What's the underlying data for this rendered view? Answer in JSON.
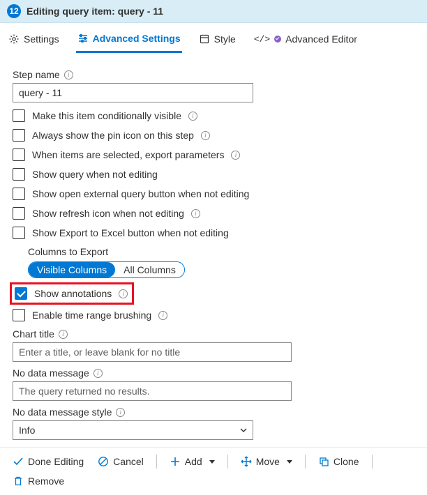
{
  "header": {
    "badge": "12",
    "title": "Editing query item: query - 11"
  },
  "tabs": {
    "settings": "Settings",
    "advanced": "Advanced Settings",
    "style": "Style",
    "editor": "Advanced Editor"
  },
  "stepName": {
    "label": "Step name",
    "value": "query - 11"
  },
  "checks": {
    "conditional": "Make this item conditionally visible",
    "pin": "Always show the pin icon on this step",
    "export": "When items are selected, export parameters",
    "showQuery": "Show query when not editing",
    "openExternal": "Show open external query button when not editing",
    "refresh": "Show refresh icon when not editing",
    "excel": "Show Export to Excel button when not editing",
    "annotations": "Show annotations",
    "brushing": "Enable time range brushing"
  },
  "columnsExport": {
    "label": "Columns to Export",
    "visible": "Visible Columns",
    "all": "All Columns"
  },
  "chartTitle": {
    "label": "Chart title",
    "placeholder": "Enter a title, or leave blank for no title"
  },
  "noData": {
    "label": "No data message",
    "value": "The query returned no results."
  },
  "noDataStyle": {
    "label": "No data message style",
    "value": "Info"
  },
  "toolbar": {
    "done": "Done Editing",
    "cancel": "Cancel",
    "add": "Add",
    "move": "Move",
    "clone": "Clone",
    "remove": "Remove"
  }
}
